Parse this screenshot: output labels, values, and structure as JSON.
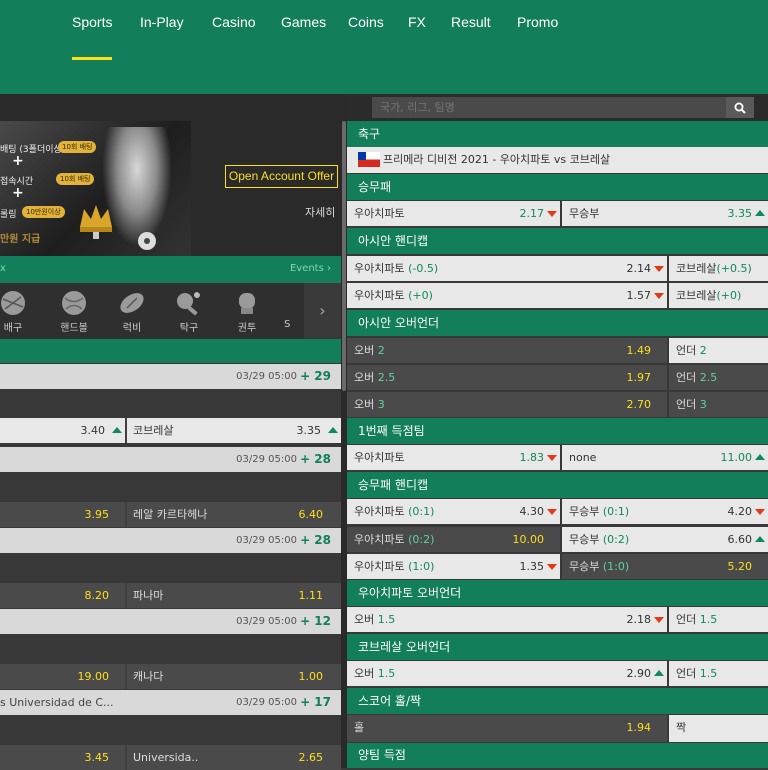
{
  "nav": {
    "tabs": [
      {
        "label": "Sports",
        "active": true
      },
      {
        "label": "In-Play",
        "active": false
      },
      {
        "label": "Casino",
        "active": false
      },
      {
        "label": "Games",
        "active": false
      },
      {
        "label": "Coins",
        "active": false
      },
      {
        "label": "FX",
        "active": false
      },
      {
        "label": "Result",
        "active": false
      },
      {
        "label": "Promo",
        "active": false
      }
    ]
  },
  "search": {
    "placeholder": "국가, 리그, 팀명",
    "icon": "search-icon"
  },
  "banner": {
    "pill_1": "10회 배팅",
    "pill_2": "10회 배팅",
    "pill_3": "10만원이상",
    "line_1": "배팅 (3폴더이상)",
    "line_2": "접속시간",
    "line_3": "롤링",
    "line_4": "만원 지급",
    "offer_button": "Open Account Offer",
    "detail_link": "자세히"
  },
  "events_strip": {
    "left": "x",
    "right": "Events ›"
  },
  "sports": [
    {
      "label": "배구",
      "icon": "volleyball-icon"
    },
    {
      "label": "핸드볼",
      "icon": "handball-icon"
    },
    {
      "label": "럭비",
      "icon": "rugby-icon"
    },
    {
      "label": "탁구",
      "icon": "table-tennis-icon"
    },
    {
      "label": "권투",
      "icon": "boxing-icon"
    },
    {
      "label": "S",
      "icon": "sport-icon"
    }
  ],
  "left_matches": [
    {
      "date": "03/29 05:00",
      "more": "+ 29",
      "odd1": "3.40",
      "team2": "코브레살",
      "odd2": "3.35"
    },
    {
      "date": "03/29 05:00",
      "more": "+ 28",
      "odd1": "3.95",
      "team2": "레알 카르타헤나",
      "odd2": "6.40"
    },
    {
      "date": "03/29 05:00",
      "more": "+ 28",
      "odd1": "8.20",
      "team2": "파나마",
      "odd2": "1.11"
    },
    {
      "date": "03/29 05:00",
      "more": "+ 12",
      "odd1": "19.00",
      "team2": "캐나다",
      "odd2": "1.00"
    },
    {
      "name": "s Universidad de C...",
      "date": "03/29 05:00",
      "more": "+ 17",
      "odd1": "3.45",
      "team2": "Universida..",
      "odd2": "2.65"
    }
  ],
  "right": {
    "sport_title": "축구",
    "match_title": "프리메라 디비전 2021 - 우아치파토 vs 코브레살",
    "sections": {
      "s1": "승무패",
      "s2": "아시안 핸디캡",
      "s3": "아시안 오버언더",
      "s4": "1번째 득점팀",
      "s5": "승무패 핸디캡",
      "s6": "우아치파토 오버언더",
      "s7": "코브레살 오버언더",
      "s8": "스코어 홀/짝",
      "s9": "양팀 득점"
    },
    "wdl": {
      "home": "우아치파토",
      "home_odd": "2.17",
      "draw": "무승부",
      "draw_odd": "3.35"
    },
    "ah": [
      {
        "team": "우아치파토",
        "line": "(-0.5)",
        "odd": "2.14",
        "away": "코브레살",
        "away_line": "(+0.5)"
      },
      {
        "team": "우아치파토",
        "line": "(+0)",
        "odd": "1.57",
        "away": "코브레살",
        "away_line": "(+0)"
      }
    ],
    "aou": [
      {
        "label": "오버",
        "line": "2",
        "odd": "1.49",
        "under": "언더",
        "under_line": "2"
      },
      {
        "label": "오버",
        "line": "2.5",
        "odd": "1.97",
        "under": "언더",
        "under_line": "2.5"
      },
      {
        "label": "오버",
        "line": "3",
        "odd": "2.70",
        "under": "언더",
        "under_line": "3"
      }
    ],
    "first": {
      "team": "우아치파토",
      "odd": "1.83",
      "none": "none",
      "none_odd": "11.00"
    },
    "hcp": [
      {
        "team": "우아치파토",
        "line": "(0:1)",
        "odd": "4.30",
        "draw": "무승부",
        "draw_line": "(0:1)",
        "draw_odd": "4.20"
      },
      {
        "team": "우아치파토",
        "line": "(0:2)",
        "odd": "10.00",
        "draw": "무승부",
        "draw_line": "(0:2)",
        "draw_odd": "6.60"
      },
      {
        "team": "우아치파토",
        "line": "(1:0)",
        "odd": "1.35",
        "draw": "무승부",
        "draw_line": "(1:0)",
        "draw_odd": "5.20"
      }
    ],
    "home_ou": {
      "label": "오버",
      "line": "1.5",
      "odd": "2.18",
      "under": "언더",
      "under_line": "1.5"
    },
    "away_ou": {
      "label": "오버",
      "line": "1.5",
      "odd": "2.90",
      "under": "언더",
      "under_line": "1.5"
    },
    "oe": {
      "odd_label": "홀",
      "odd_val": "1.94",
      "even_label": "짝"
    }
  }
}
